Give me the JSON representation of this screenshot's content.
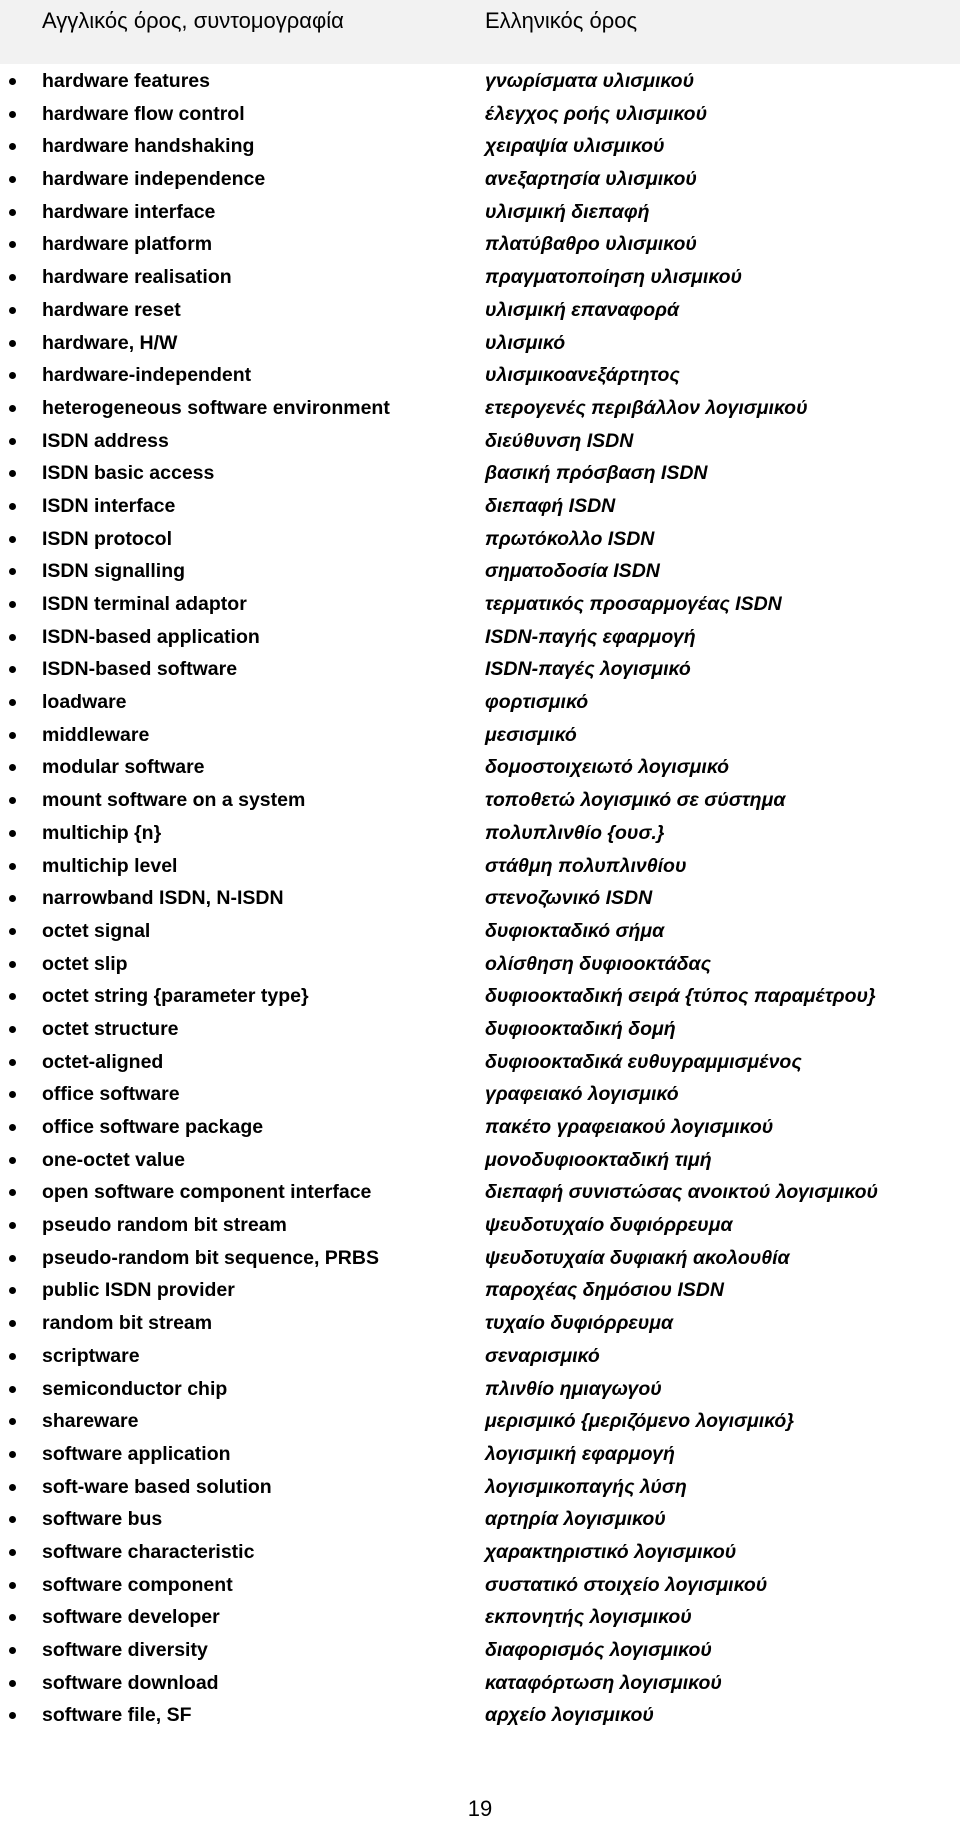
{
  "header": {
    "english_column": "Αγγλικός όρος, συντομογραφία",
    "greek_column": "Ελληνικός όρος"
  },
  "terms": [
    {
      "en": "hardware features",
      "gr": "γνωρίσματα υλισμικού"
    },
    {
      "en": "hardware flow control",
      "gr": "έλεγχος ροής υλισμικού"
    },
    {
      "en": "hardware handshaking",
      "gr": "χειραψία υλισμικού"
    },
    {
      "en": "hardware independence",
      "gr": "ανεξαρτησία υλισμικού"
    },
    {
      "en": "hardware interface",
      "gr": "υλισμική διεπαφή"
    },
    {
      "en": "hardware platform",
      "gr": "πλατύβαθρο υλισμικού"
    },
    {
      "en": "hardware realisation",
      "gr": "πραγματοποίηση υλισμικού"
    },
    {
      "en": "hardware reset",
      "gr": "υλισμική επαναφορά"
    },
    {
      "en": "hardware, H/W",
      "gr": "υλισμικό"
    },
    {
      "en": "hardware-independent",
      "gr": "υλισμικοανεξάρτητος"
    },
    {
      "en": "heterogeneous software environment",
      "gr": "ετερογενές περιβάλλον λογισμικού"
    },
    {
      "en": "ISDN address",
      "gr": "διεύθυνση ISDN"
    },
    {
      "en": "ISDN basic access",
      "gr": "βασική πρόσβαση ISDN"
    },
    {
      "en": "ISDN interface",
      "gr": "διεπαφή ISDN"
    },
    {
      "en": "ISDN protocol",
      "gr": "πρωτόκολλο ISDN"
    },
    {
      "en": "ISDN signalling",
      "gr": "σηματοδοσία ISDN"
    },
    {
      "en": "ISDN terminal adaptor",
      "gr": "τερματικός προσαρμογέας ISDN"
    },
    {
      "en": "ISDN-based application",
      "gr": "ISDN-παγής εφαρμογή"
    },
    {
      "en": "ISDN-based software",
      "gr": "ISDN-παγές λογισμικό"
    },
    {
      "en": "loadware",
      "gr": "φορτισμικό"
    },
    {
      "en": "middleware",
      "gr": "μεσισμικό"
    },
    {
      "en": "modular software",
      "gr": "δομοστοιχειωτό λογισμικό"
    },
    {
      "en": "mount software on a system",
      "gr": "τοποθετώ λογισμικό σε σύστημα"
    },
    {
      "en": "multichip {n}",
      "gr": "πολυπλινθίο {ουσ.}"
    },
    {
      "en": "multichip level",
      "gr": "στάθμη πολυπλινθίου"
    },
    {
      "en": "narrowband ISDN, N-ISDN",
      "gr": "στενοζωνικό ISDN"
    },
    {
      "en": "octet signal",
      "gr": "δυφιοκταδικό σήμα"
    },
    {
      "en": "octet slip",
      "gr": "ολίσθηση δυφιοοκτάδας"
    },
    {
      "en": "octet string {parameter type}",
      "gr": "δυφιοοκταδική σειρά {τύπος παραμέτρου}"
    },
    {
      "en": "octet structure",
      "gr": "δυφιοοκταδική δομή"
    },
    {
      "en": "octet-aligned",
      "gr": "δυφιοοκταδικά ευθυγραμμισμένος"
    },
    {
      "en": "office software",
      "gr": "γραφειακό λογισμικό"
    },
    {
      "en": "office software package",
      "gr": "πακέτο γραφειακού λογισμικού"
    },
    {
      "en": "one-octet value",
      "gr": "μονοδυφιοοκταδική τιμή"
    },
    {
      "en": "open software component interface",
      "gr": "διεπαφή συνιστώσας ανοικτού λογισμικού"
    },
    {
      "en": "pseudo random bit stream",
      "gr": "ψευδοτυχαίο δυφιόρρευμα"
    },
    {
      "en": "pseudo-random bit sequence, PRBS",
      "gr": "ψευδοτυχαία δυφιακή ακολουθία"
    },
    {
      "en": "public ISDN provider",
      "gr": "παροχέας δημόσιου ISDN"
    },
    {
      "en": "random bit stream",
      "gr": "τυχαίο δυφιόρρευμα"
    },
    {
      "en": "scriptware",
      "gr": "σεναρισμικό"
    },
    {
      "en": "semiconductor chip",
      "gr": "πλινθίο ημιαγωγού"
    },
    {
      "en": "shareware",
      "gr": "μερισμικό {μεριζόμενο λογισμικό}"
    },
    {
      "en": "software application",
      "gr": "λογισμική εφαρμογή"
    },
    {
      "en": "soft-ware based solution",
      "gr": "λογισμικοπαγής λύση"
    },
    {
      "en": "software bus",
      "gr": "αρτηρία λογισμικού"
    },
    {
      "en": "software characteristic",
      "gr": "χαρακτηριστικό λογισμικού"
    },
    {
      "en": "software component",
      "gr": "συστατικό στοιχείο λογισμικού"
    },
    {
      "en": "software developer",
      "gr": "εκπονητής λογισμικού"
    },
    {
      "en": "software diversity",
      "gr": "διαφορισμός λογισμικού"
    },
    {
      "en": "software download",
      "gr": "καταφόρτωση λογισμικού"
    },
    {
      "en": "software file, SF",
      "gr": "αρχείο λογισμικού"
    }
  ],
  "footer": {
    "page_number": "19"
  }
}
